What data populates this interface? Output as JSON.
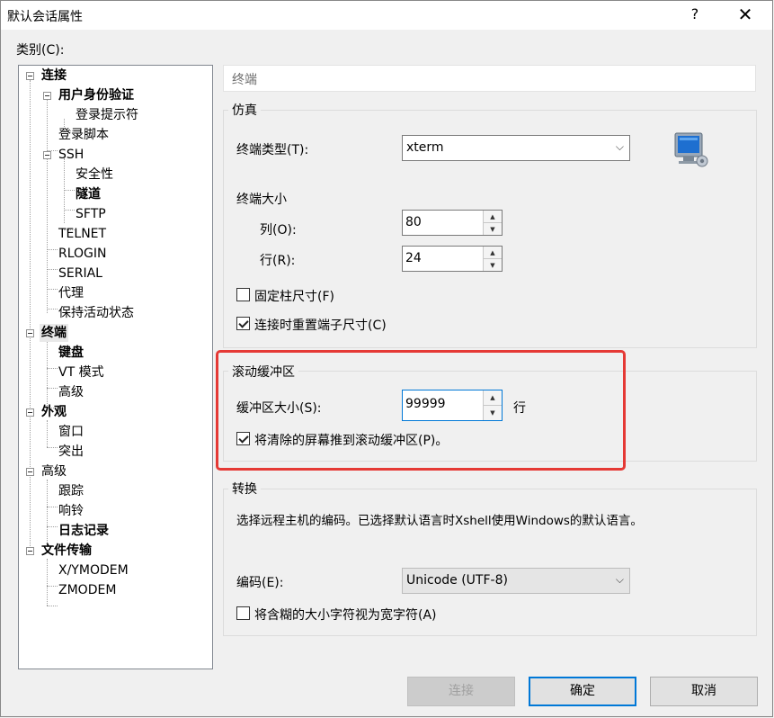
{
  "window": {
    "title": "默认会话属性",
    "help_label": "?",
    "close_label": "✕"
  },
  "sidebar": {
    "label": "类别(C):",
    "tree": {
      "connection": "连接",
      "auth": "用户身份验证",
      "login_prompt": "登录提示符",
      "login_script": "登录脚本",
      "ssh": "SSH",
      "security": "安全性",
      "tunnel": "隧道",
      "sftp": "SFTP",
      "telnet": "TELNET",
      "rlogin": "RLOGIN",
      "serial": "SERIAL",
      "proxy": "代理",
      "keepalive": "保持活动状态",
      "terminal": "终端",
      "keyboard": "键盘",
      "vt_mode": "VT 模式",
      "advanced_term": "高级",
      "appearance": "外观",
      "window": "窗口",
      "highlight": "突出",
      "advanced": "高级",
      "trace": "跟踪",
      "bell": "响铃",
      "logging": "日志记录",
      "file_transfer": "文件传输",
      "xymodem": "X/YMODEM",
      "zmodem": "ZMODEM"
    }
  },
  "panel": {
    "title": "终端",
    "emulation": {
      "group_label": "仿真",
      "terminal_type_label": "终端类型(T):",
      "terminal_type_value": "xterm",
      "size_label": "终端大小",
      "cols_label": "列(O):",
      "cols_value": "80",
      "rows_label": "行(R):",
      "rows_value": "24",
      "fixed_cols_label": "固定柱尺寸(F)",
      "fixed_cols_checked": false,
      "reset_on_connect_label": "连接时重置端子尺寸(C)",
      "reset_on_connect_checked": true
    },
    "scrollback": {
      "group_label": "滚动缓冲区",
      "size_label": "缓冲区大小(S):",
      "size_value": "99999",
      "unit": "行",
      "push_cleared_label": "将清除的屏幕推到滚动缓冲区(P)。",
      "push_cleared_checked": true
    },
    "translation": {
      "group_label": "转换",
      "description": "选择远程主机的编码。已选择默认语言时Xshell使用Windows的默认语言。",
      "encoding_label": "编码(E):",
      "encoding_value": "Unicode (UTF-8)",
      "ambiguous_label": "将含糊的大小字符视为宽字符(A)",
      "ambiguous_checked": false
    }
  },
  "buttons": {
    "connect": "连接",
    "ok": "确定",
    "cancel": "取消"
  },
  "colors": {
    "accent": "#0078d7",
    "highlight_box": "#e53935"
  }
}
